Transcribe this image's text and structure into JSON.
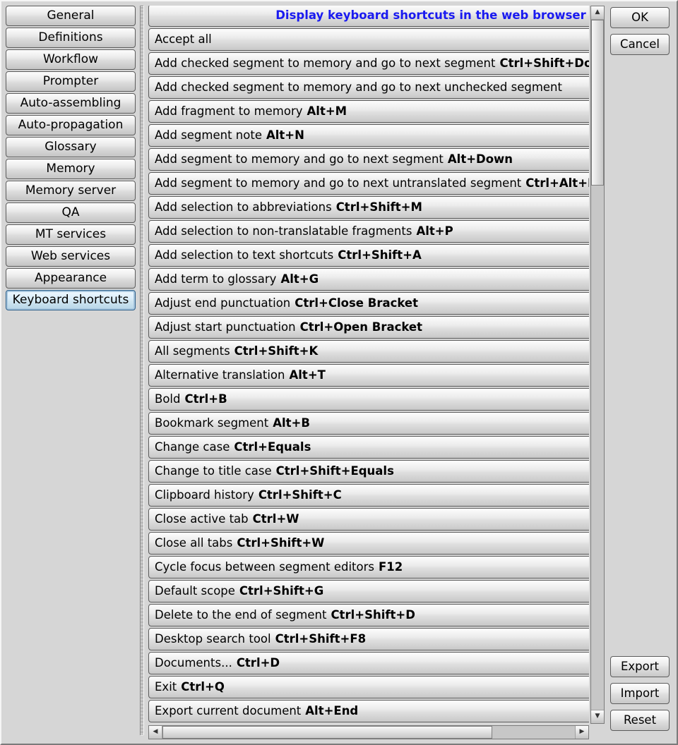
{
  "sidebar": {
    "items": [
      "General",
      "Definitions",
      "Workflow",
      "Prompter",
      "Auto-assembling",
      "Auto-propagation",
      "Glossary",
      "Memory",
      "Memory server",
      "QA",
      "MT services",
      "Web services",
      "Appearance",
      "Keyboard shortcuts"
    ],
    "selected_index": 13
  },
  "header_link": "Display keyboard shortcuts in the web browser",
  "shortcuts": [
    {
      "name": "Accept all",
      "key": ""
    },
    {
      "name": "Add checked segment to memory and go to next segment",
      "key": "Ctrl+Shift+Down"
    },
    {
      "name": "Add checked segment to memory and go to next unchecked segment",
      "key": ""
    },
    {
      "name": "Add fragment to memory",
      "key": "Alt+M"
    },
    {
      "name": "Add segment note",
      "key": "Alt+N"
    },
    {
      "name": "Add segment to memory and go to next segment",
      "key": "Alt+Down"
    },
    {
      "name": "Add segment to memory and go to next untranslated segment",
      "key": "Ctrl+Alt+Down"
    },
    {
      "name": "Add selection to abbreviations",
      "key": "Ctrl+Shift+M"
    },
    {
      "name": "Add selection to non-translatable fragments",
      "key": "Alt+P"
    },
    {
      "name": "Add selection to text shortcuts",
      "key": "Ctrl+Shift+A"
    },
    {
      "name": "Add term to glossary",
      "key": "Alt+G"
    },
    {
      "name": "Adjust end punctuation",
      "key": "Ctrl+Close Bracket"
    },
    {
      "name": "Adjust start punctuation",
      "key": "Ctrl+Open Bracket"
    },
    {
      "name": "All segments",
      "key": "Ctrl+Shift+K"
    },
    {
      "name": "Alternative translation",
      "key": "Alt+T"
    },
    {
      "name": "Bold",
      "key": "Ctrl+B"
    },
    {
      "name": "Bookmark segment",
      "key": "Alt+B"
    },
    {
      "name": "Change case",
      "key": "Ctrl+Equals"
    },
    {
      "name": "Change to title case",
      "key": "Ctrl+Shift+Equals"
    },
    {
      "name": "Clipboard history",
      "key": "Ctrl+Shift+C"
    },
    {
      "name": "Close active tab",
      "key": "Ctrl+W"
    },
    {
      "name": "Close all tabs",
      "key": "Ctrl+Shift+W"
    },
    {
      "name": "Cycle focus between segment editors",
      "key": "F12"
    },
    {
      "name": "Default scope",
      "key": "Ctrl+Shift+G"
    },
    {
      "name": "Delete to the end of segment",
      "key": "Ctrl+Shift+D"
    },
    {
      "name": "Desktop search tool",
      "key": "Ctrl+Shift+F8"
    },
    {
      "name": "Documents...",
      "key": "Ctrl+D"
    },
    {
      "name": "Exit",
      "key": "Ctrl+Q"
    },
    {
      "name": "Export current document",
      "key": "Alt+End"
    }
  ],
  "buttons": {
    "ok": "OK",
    "cancel": "Cancel",
    "export": "Export",
    "import": "Import",
    "reset": "Reset"
  }
}
